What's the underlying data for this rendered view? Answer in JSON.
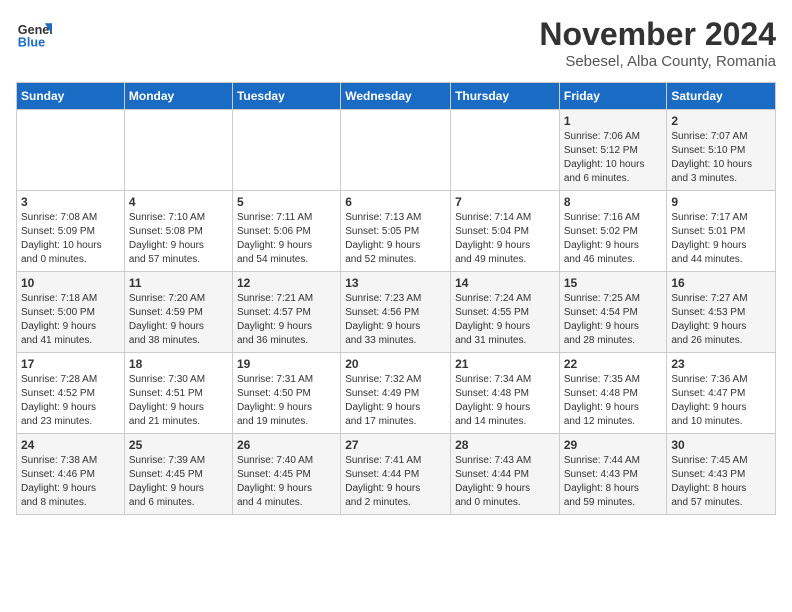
{
  "header": {
    "logo_general": "General",
    "logo_blue": "Blue",
    "title": "November 2024",
    "subtitle": "Sebesel, Alba County, Romania"
  },
  "calendar": {
    "weekdays": [
      "Sunday",
      "Monday",
      "Tuesday",
      "Wednesday",
      "Thursday",
      "Friday",
      "Saturday"
    ],
    "weeks": [
      [
        {
          "day": "",
          "info": ""
        },
        {
          "day": "",
          "info": ""
        },
        {
          "day": "",
          "info": ""
        },
        {
          "day": "",
          "info": ""
        },
        {
          "day": "",
          "info": ""
        },
        {
          "day": "1",
          "info": "Sunrise: 7:06 AM\nSunset: 5:12 PM\nDaylight: 10 hours\nand 6 minutes."
        },
        {
          "day": "2",
          "info": "Sunrise: 7:07 AM\nSunset: 5:10 PM\nDaylight: 10 hours\nand 3 minutes."
        }
      ],
      [
        {
          "day": "3",
          "info": "Sunrise: 7:08 AM\nSunset: 5:09 PM\nDaylight: 10 hours\nand 0 minutes."
        },
        {
          "day": "4",
          "info": "Sunrise: 7:10 AM\nSunset: 5:08 PM\nDaylight: 9 hours\nand 57 minutes."
        },
        {
          "day": "5",
          "info": "Sunrise: 7:11 AM\nSunset: 5:06 PM\nDaylight: 9 hours\nand 54 minutes."
        },
        {
          "day": "6",
          "info": "Sunrise: 7:13 AM\nSunset: 5:05 PM\nDaylight: 9 hours\nand 52 minutes."
        },
        {
          "day": "7",
          "info": "Sunrise: 7:14 AM\nSunset: 5:04 PM\nDaylight: 9 hours\nand 49 minutes."
        },
        {
          "day": "8",
          "info": "Sunrise: 7:16 AM\nSunset: 5:02 PM\nDaylight: 9 hours\nand 46 minutes."
        },
        {
          "day": "9",
          "info": "Sunrise: 7:17 AM\nSunset: 5:01 PM\nDaylight: 9 hours\nand 44 minutes."
        }
      ],
      [
        {
          "day": "10",
          "info": "Sunrise: 7:18 AM\nSunset: 5:00 PM\nDaylight: 9 hours\nand 41 minutes."
        },
        {
          "day": "11",
          "info": "Sunrise: 7:20 AM\nSunset: 4:59 PM\nDaylight: 9 hours\nand 38 minutes."
        },
        {
          "day": "12",
          "info": "Sunrise: 7:21 AM\nSunset: 4:57 PM\nDaylight: 9 hours\nand 36 minutes."
        },
        {
          "day": "13",
          "info": "Sunrise: 7:23 AM\nSunset: 4:56 PM\nDaylight: 9 hours\nand 33 minutes."
        },
        {
          "day": "14",
          "info": "Sunrise: 7:24 AM\nSunset: 4:55 PM\nDaylight: 9 hours\nand 31 minutes."
        },
        {
          "day": "15",
          "info": "Sunrise: 7:25 AM\nSunset: 4:54 PM\nDaylight: 9 hours\nand 28 minutes."
        },
        {
          "day": "16",
          "info": "Sunrise: 7:27 AM\nSunset: 4:53 PM\nDaylight: 9 hours\nand 26 minutes."
        }
      ],
      [
        {
          "day": "17",
          "info": "Sunrise: 7:28 AM\nSunset: 4:52 PM\nDaylight: 9 hours\nand 23 minutes."
        },
        {
          "day": "18",
          "info": "Sunrise: 7:30 AM\nSunset: 4:51 PM\nDaylight: 9 hours\nand 21 minutes."
        },
        {
          "day": "19",
          "info": "Sunrise: 7:31 AM\nSunset: 4:50 PM\nDaylight: 9 hours\nand 19 minutes."
        },
        {
          "day": "20",
          "info": "Sunrise: 7:32 AM\nSunset: 4:49 PM\nDaylight: 9 hours\nand 17 minutes."
        },
        {
          "day": "21",
          "info": "Sunrise: 7:34 AM\nSunset: 4:48 PM\nDaylight: 9 hours\nand 14 minutes."
        },
        {
          "day": "22",
          "info": "Sunrise: 7:35 AM\nSunset: 4:48 PM\nDaylight: 9 hours\nand 12 minutes."
        },
        {
          "day": "23",
          "info": "Sunrise: 7:36 AM\nSunset: 4:47 PM\nDaylight: 9 hours\nand 10 minutes."
        }
      ],
      [
        {
          "day": "24",
          "info": "Sunrise: 7:38 AM\nSunset: 4:46 PM\nDaylight: 9 hours\nand 8 minutes."
        },
        {
          "day": "25",
          "info": "Sunrise: 7:39 AM\nSunset: 4:45 PM\nDaylight: 9 hours\nand 6 minutes."
        },
        {
          "day": "26",
          "info": "Sunrise: 7:40 AM\nSunset: 4:45 PM\nDaylight: 9 hours\nand 4 minutes."
        },
        {
          "day": "27",
          "info": "Sunrise: 7:41 AM\nSunset: 4:44 PM\nDaylight: 9 hours\nand 2 minutes."
        },
        {
          "day": "28",
          "info": "Sunrise: 7:43 AM\nSunset: 4:44 PM\nDaylight: 9 hours\nand 0 minutes."
        },
        {
          "day": "29",
          "info": "Sunrise: 7:44 AM\nSunset: 4:43 PM\nDaylight: 8 hours\nand 59 minutes."
        },
        {
          "day": "30",
          "info": "Sunrise: 7:45 AM\nSunset: 4:43 PM\nDaylight: 8 hours\nand 57 minutes."
        }
      ]
    ]
  }
}
